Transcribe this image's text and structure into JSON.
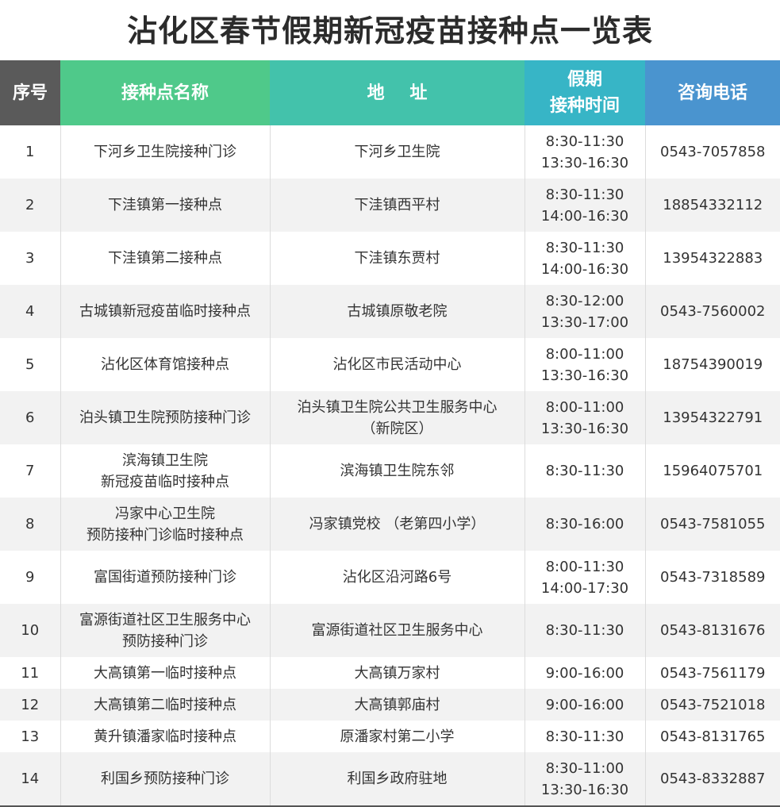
{
  "title": "沾化区春节假期新冠疫苗接种点一览表",
  "header": {
    "col_index": "序号",
    "col_name": "接种点名称",
    "col_address": "地 址",
    "col_time_line1": "假期",
    "col_time_line2": "接种时间",
    "col_phone": "咨询电话"
  },
  "header_colors": {
    "index": "#5a5a5a",
    "name": "#4fc98a",
    "address": "#43c2ab",
    "time": "#37b5c6",
    "phone": "#4a94cf"
  },
  "rows": [
    {
      "index": "1",
      "name": [
        "下河乡卫生院接种门诊"
      ],
      "address": [
        "下河乡卫生院"
      ],
      "time": [
        "8:30-11:30",
        "13:30-16:30"
      ],
      "phone": "0543-7057858"
    },
    {
      "index": "2",
      "name": [
        "下洼镇第一接种点"
      ],
      "address": [
        "下洼镇西平村"
      ],
      "time": [
        "8:30-11:30",
        "14:00-16:30"
      ],
      "phone": "18854332112"
    },
    {
      "index": "3",
      "name": [
        "下洼镇第二接种点"
      ],
      "address": [
        "下洼镇东贾村"
      ],
      "time": [
        "8:30-11:30",
        "14:00-16:30"
      ],
      "phone": "13954322883"
    },
    {
      "index": "4",
      "name": [
        "古城镇新冠疫苗临时接种点"
      ],
      "address": [
        "古城镇原敬老院"
      ],
      "time": [
        "8:30-12:00",
        "13:30-17:00"
      ],
      "phone": "0543-7560002"
    },
    {
      "index": "5",
      "name": [
        "沾化区体育馆接种点"
      ],
      "address": [
        "沾化区市民活动中心"
      ],
      "time": [
        "8:00-11:00",
        "13:30-16:30"
      ],
      "phone": "18754390019"
    },
    {
      "index": "6",
      "name": [
        "泊头镇卫生院预防接种门诊"
      ],
      "address": [
        "泊头镇卫生院公共卫生服务中心",
        "（新院区）"
      ],
      "time": [
        "8:00-11:00",
        "13:30-16:30"
      ],
      "phone": "13954322791"
    },
    {
      "index": "7",
      "name": [
        "滨海镇卫生院",
        "新冠疫苗临时接种点"
      ],
      "address": [
        "滨海镇卫生院东邻"
      ],
      "time": [
        "8:30-11:30"
      ],
      "phone": "15964075701"
    },
    {
      "index": "8",
      "name": [
        "冯家中心卫生院",
        "预防接种门诊临时接种点"
      ],
      "address": [
        "冯家镇党校 （老第四小学）"
      ],
      "time": [
        "8:30-16:00"
      ],
      "phone": "0543-7581055"
    },
    {
      "index": "9",
      "name": [
        "富国街道预防接种门诊"
      ],
      "address": [
        "沾化区沿河路6号"
      ],
      "time": [
        "8:00-11:30",
        "14:00-17:30"
      ],
      "phone": "0543-7318589"
    },
    {
      "index": "10",
      "name": [
        "富源街道社区卫生服务中心",
        "预防接种门诊"
      ],
      "address": [
        "富源街道社区卫生服务中心"
      ],
      "time": [
        "8:30-11:30"
      ],
      "phone": "0543-8131676"
    },
    {
      "index": "11",
      "name": [
        "大高镇第一临时接种点"
      ],
      "address": [
        "大高镇万家村"
      ],
      "time": [
        "9:00-16:00"
      ],
      "phone": "0543-7561179"
    },
    {
      "index": "12",
      "name": [
        "大高镇第二临时接种点"
      ],
      "address": [
        "大高镇郭庙村"
      ],
      "time": [
        "9:00-16:00"
      ],
      "phone": "0543-7521018"
    },
    {
      "index": "13",
      "name": [
        "黄升镇潘家临时接种点"
      ],
      "address": [
        "原潘家村第二小学"
      ],
      "time": [
        "8:30-11:30"
      ],
      "phone": "0543-8131765"
    },
    {
      "index": "14",
      "name": [
        "利国乡预防接种门诊"
      ],
      "address": [
        "利国乡政府驻地"
      ],
      "time": [
        "8:30-11:00",
        "13:30-16:30"
      ],
      "phone": "0543-8332887"
    }
  ]
}
